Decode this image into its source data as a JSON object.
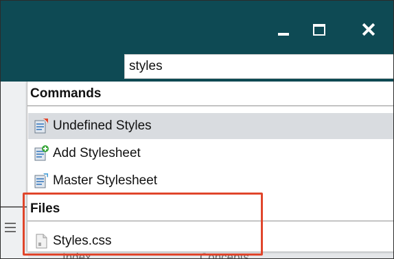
{
  "window": {
    "minimize_icon": "minimize-icon",
    "maximize_icon": "maximize-icon",
    "close_icon": "close-icon",
    "titlebar_color": "#0e4a54"
  },
  "search": {
    "value": "styles"
  },
  "dropdown": {
    "sections": [
      {
        "header": "Commands",
        "items": [
          {
            "label": "Undefined Styles",
            "icon": "undefined-styles-icon",
            "selected": true
          },
          {
            "label": "Add Stylesheet",
            "icon": "add-stylesheet-icon",
            "selected": false
          },
          {
            "label": "Master Stylesheet",
            "icon": "master-stylesheet-icon",
            "selected": false
          }
        ]
      },
      {
        "header": "Files",
        "items": [
          {
            "label": "Styles.css",
            "icon": "css-file-icon",
            "selected": false
          }
        ]
      }
    ]
  },
  "background": {
    "tabs": [
      "Index",
      "Concepts"
    ]
  },
  "annotation": {
    "highlight_color": "#e0452b"
  }
}
